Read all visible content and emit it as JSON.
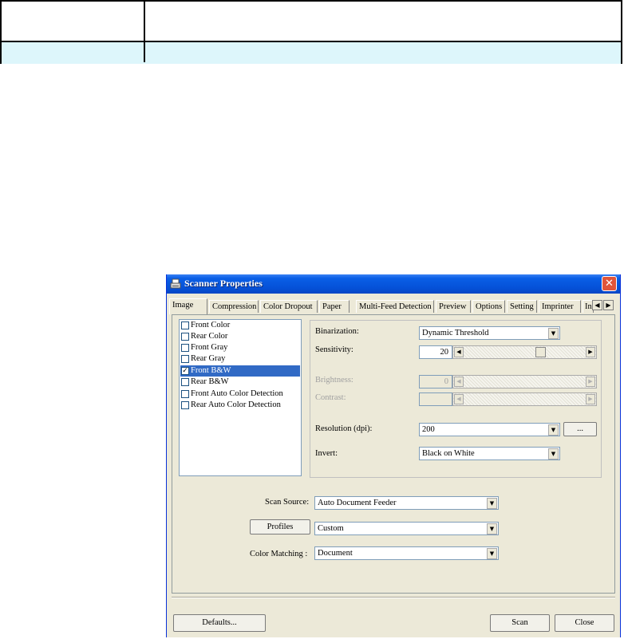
{
  "window": {
    "title": "Scanner Properties"
  },
  "tabs": [
    {
      "label": "Image"
    },
    {
      "label": "Compression"
    },
    {
      "label": "Color Dropout"
    },
    {
      "label": "Paper"
    },
    {
      "label": "Multi-Feed Detection"
    },
    {
      "label": "Preview"
    },
    {
      "label": "Options"
    },
    {
      "label": "Setting"
    },
    {
      "label": "Imprinter"
    },
    {
      "label": "In"
    }
  ],
  "image_types": [
    {
      "label": "Front Color",
      "checked": false
    },
    {
      "label": "Rear Color",
      "checked": false
    },
    {
      "label": "Front Gray",
      "checked": false
    },
    {
      "label": "Rear Gray",
      "checked": false
    },
    {
      "label": "Front B&W",
      "checked": true
    },
    {
      "label": "Rear B&W",
      "checked": false
    },
    {
      "label": "Front Auto Color Detection",
      "checked": false
    },
    {
      "label": "Rear Auto Color Detection",
      "checked": false
    }
  ],
  "settings": {
    "binarization_label": "Binarization:",
    "binarization_value": "Dynamic Threshold",
    "sensitivity_label": "Sensitivity:",
    "sensitivity_value": "20",
    "brightness_label": "Brightness:",
    "brightness_value": "0",
    "contrast_label": "Contrast:",
    "resolution_label": "Resolution (dpi):",
    "resolution_value": "200",
    "resolution_more": "...",
    "invert_label": "Invert:",
    "invert_value": "Black on White"
  },
  "source": {
    "scan_source_label": "Scan Source:",
    "scan_source_value": "Auto Document Feeder",
    "profiles_button": "Profiles",
    "profiles_value": "Custom",
    "color_matching_label": "Color Matching :",
    "color_matching_value": "Document"
  },
  "footer": {
    "defaults_button": "Defaults...",
    "scan_button": "Scan",
    "close_button": "Close"
  },
  "icons": {
    "scanner": "scanner-icon",
    "close": "close-icon",
    "combo": "chevron-down-icon",
    "left": "arrow-left-icon",
    "right": "arrow-right-icon",
    "check": "checkmark-icon"
  }
}
